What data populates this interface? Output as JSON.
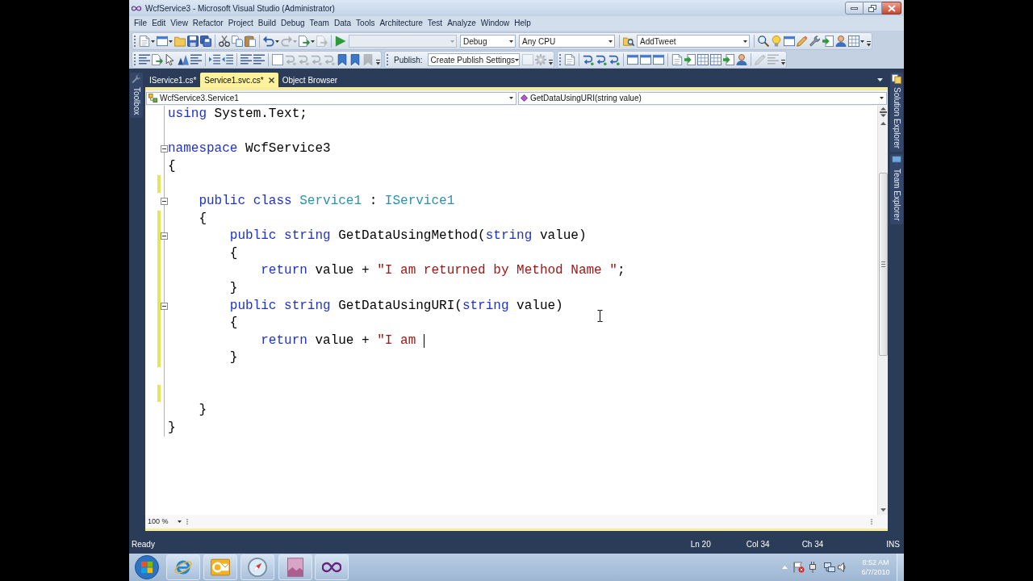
{
  "window": {
    "title": "WcfService3 - Microsoft Visual Studio (Administrator)"
  },
  "menu": [
    "File",
    "Edit",
    "View",
    "Refactor",
    "Project",
    "Build",
    "Debug",
    "Team",
    "Data",
    "Tools",
    "Architecture",
    "Test",
    "Analyze",
    "Window",
    "Help"
  ],
  "toolbar_rows": [
    [
      {
        "groups": [
          [
            {
              "kind": "button",
              "disabled": false
            },
            {
              "kind": "button",
              "disabled": false
            },
            {
              "kind": "button",
              "disabled": false
            },
            {
              "kind": "button",
              "disabled": false
            },
            {
              "kind": "button",
              "disabled": false
            }
          ],
          [
            {
              "kind": "button",
              "disabled": false
            },
            {
              "kind": "button",
              "disabled": false
            },
            {
              "kind": "button",
              "disabled": false
            }
          ],
          [
            {
              "kind": "button",
              "disabled": false
            },
            {
              "kind": "button",
              "disabled": true
            },
            {
              "kind": "button",
              "disabled": false
            },
            {
              "kind": "button",
              "disabled": true
            }
          ],
          [
            {
              "kind": "button",
              "disabled": false
            },
            {
              "kind": "combo",
              "disabled": true
            },
            {
              "kind": "combo",
              "value": "Debug",
              "disabled": false
            },
            {
              "kind": "combo",
              "value": "Any CPU",
              "disabled": false
            }
          ],
          [
            {
              "kind": "button",
              "disabled": false
            },
            {
              "kind": "combo",
              "value": "AddTweet",
              "disabled": false
            }
          ],
          [
            {
              "kind": "button",
              "disabled": false
            },
            {
              "kind": "button",
              "disabled": false
            },
            {
              "kind": "button",
              "disabled": false
            },
            {
              "kind": "button",
              "disabled": false
            },
            {
              "kind": "button",
              "disabled": false
            },
            {
              "kind": "button",
              "disabled": false
            },
            {
              "kind": "button",
              "disabled": false
            },
            {
              "kind": "button",
              "disabled": false
            }
          ]
        ]
      }
    ],
    [
      {
        "groups": [
          [
            {
              "kind": "button",
              "disabled": false
            },
            {
              "kind": "button",
              "disabled": false
            },
            {
              "kind": "button",
              "disabled": false
            },
            {
              "kind": "button",
              "disabled": false
            },
            {
              "kind": "button",
              "disabled": false
            }
          ],
          [
            {
              "kind": "button",
              "disabled": false
            },
            {
              "kind": "button",
              "disabled": false
            }
          ],
          [
            {
              "kind": "button",
              "disabled": false
            },
            {
              "kind": "button",
              "disabled": false
            }
          ],
          [
            {
              "kind": "button",
              "disabled": false
            },
            {
              "kind": "button",
              "disabled": true
            },
            {
              "kind": "button",
              "disabled": true
            },
            {
              "kind": "button",
              "disabled": true
            },
            {
              "kind": "button",
              "disabled": true
            },
            {
              "kind": "button",
              "disabled": false
            },
            {
              "kind": "button",
              "disabled": false
            },
            {
              "kind": "button",
              "disabled": true
            }
          ]
        ]
      },
      {
        "groups": [
          [
            {
              "kind": "label",
              "text": "Publish:"
            },
            {
              "kind": "combo",
              "value": "Create Publish Settings",
              "disabled": false
            },
            {
              "kind": "button",
              "disabled": true
            },
            {
              "kind": "button",
              "disabled": true
            }
          ]
        ]
      },
      {
        "groups": [
          [
            {
              "kind": "button",
              "disabled": false
            }
          ],
          [
            {
              "kind": "button",
              "disabled": false
            },
            {
              "kind": "button",
              "disabled": false
            },
            {
              "kind": "button",
              "disabled": false
            }
          ],
          [
            {
              "kind": "button",
              "disabled": false
            },
            {
              "kind": "button",
              "disabled": false
            },
            {
              "kind": "button",
              "disabled": false
            }
          ],
          [
            {
              "kind": "button",
              "disabled": false
            },
            {
              "kind": "button",
              "disabled": false
            },
            {
              "kind": "button",
              "disabled": false
            },
            {
              "kind": "button",
              "disabled": false
            },
            {
              "kind": "button",
              "disabled": false
            },
            {
              "kind": "button",
              "disabled": false
            }
          ],
          [
            {
              "kind": "button",
              "disabled": true
            },
            {
              "kind": "button",
              "disabled": true
            }
          ]
        ]
      }
    ]
  ],
  "document_tabs": [
    {
      "label": "IService1.cs*",
      "selected": false
    },
    {
      "label": "Service1.svc.cs*",
      "selected": true
    },
    {
      "label": "Object Browser",
      "selected": false
    }
  ],
  "left_panel_tabs": [
    {
      "label": "Toolbox"
    }
  ],
  "right_panel_tabs": [
    {
      "label": "Solution Explorer"
    },
    {
      "label": "Team Explorer"
    }
  ],
  "navigation_bar": {
    "types": "WcfService3.Service1",
    "members": "GetDataUsingURI(string value)"
  },
  "code_lines": [
    {
      "tokens": [
        {
          "kind": "keyword",
          "text": "using"
        },
        {
          "kind": "plain",
          "text": " System.Text;"
        }
      ],
      "changed": false,
      "fold": false,
      "caret": false
    },
    {
      "changed": false,
      "fold": false,
      "caret": false
    },
    {
      "tokens": [
        {
          "kind": "keyword",
          "text": "namespace"
        },
        {
          "kind": "plain",
          "text": " WcfService3"
        }
      ],
      "changed": false,
      "fold": true,
      "caret": false
    },
    {
      "tokens": [
        {
          "kind": "plain",
          "text": "{"
        }
      ],
      "changed": false,
      "fold": false,
      "caret": false
    },
    {
      "changed": true,
      "fold": false,
      "caret": false
    },
    {
      "tokens": [
        {
          "kind": "keyword",
          "text": "    public "
        },
        {
          "kind": "keyword",
          "text": "class "
        },
        {
          "kind": "type",
          "text": "Service1"
        },
        {
          "kind": "plain",
          "text": " : "
        },
        {
          "kind": "type",
          "text": "IService1"
        }
      ],
      "changed": false,
      "fold": true,
      "caret": false
    },
    {
      "tokens": [
        {
          "kind": "plain",
          "text": "    {"
        }
      ],
      "changed": true,
      "fold": false,
      "caret": false
    },
    {
      "tokens": [
        {
          "kind": "keyword",
          "text": "        public "
        },
        {
          "kind": "keyword",
          "text": "string"
        },
        {
          "kind": "plain",
          "text": " GetDataUsingMethod("
        },
        {
          "kind": "keyword",
          "text": "string"
        },
        {
          "kind": "plain",
          "text": " value)"
        }
      ],
      "changed": true,
      "fold": true,
      "caret": false
    },
    {
      "tokens": [
        {
          "kind": "plain",
          "text": "        {"
        }
      ],
      "changed": true,
      "fold": false,
      "caret": false
    },
    {
      "tokens": [
        {
          "kind": "keyword",
          "text": "            return"
        },
        {
          "kind": "plain",
          "text": " value + "
        },
        {
          "kind": "string",
          "text": "\"I am returned by Method Name \""
        },
        {
          "kind": "plain",
          "text": ";"
        }
      ],
      "changed": true,
      "fold": false,
      "caret": false
    },
    {
      "tokens": [
        {
          "kind": "plain",
          "text": "        }"
        }
      ],
      "changed": true,
      "fold": false,
      "caret": false
    },
    {
      "tokens": [
        {
          "kind": "keyword",
          "text": "        public "
        },
        {
          "kind": "keyword",
          "text": "string"
        },
        {
          "kind": "plain",
          "text": " GetDataUsingURI("
        },
        {
          "kind": "keyword",
          "text": "string"
        },
        {
          "kind": "plain",
          "text": " value)"
        }
      ],
      "changed": true,
      "fold": true,
      "caret": false
    },
    {
      "tokens": [
        {
          "kind": "plain",
          "text": "        {"
        }
      ],
      "changed": true,
      "fold": false,
      "caret": false
    },
    {
      "tokens": [
        {
          "kind": "keyword",
          "text": "            return"
        },
        {
          "kind": "plain",
          "text": " value + "
        },
        {
          "kind": "string",
          "text": "\"I am "
        }
      ],
      "changed": true,
      "fold": false,
      "caret": true
    },
    {
      "tokens": [
        {
          "kind": "plain",
          "text": "        }"
        }
      ],
      "changed": true,
      "fold": false,
      "caret": false
    },
    {
      "changed": false,
      "fold": false,
      "caret": false
    },
    {
      "changed": true,
      "fold": false,
      "caret": false
    },
    {
      "tokens": [
        {
          "kind": "plain",
          "text": "    }"
        }
      ],
      "changed": false,
      "fold": false,
      "caret": false
    },
    {
      "tokens": [
        {
          "kind": "plain",
          "text": "}"
        }
      ],
      "changed": false,
      "fold": false,
      "caret": false
    }
  ],
  "zoom": "100 %",
  "status_bar": {
    "message": "Ready",
    "line": "Ln 20",
    "column": "Col 34",
    "character": "Ch 34",
    "mode": "INS"
  },
  "taskbar": {
    "time": "8:52 AM",
    "date": "6/7/2010"
  }
}
